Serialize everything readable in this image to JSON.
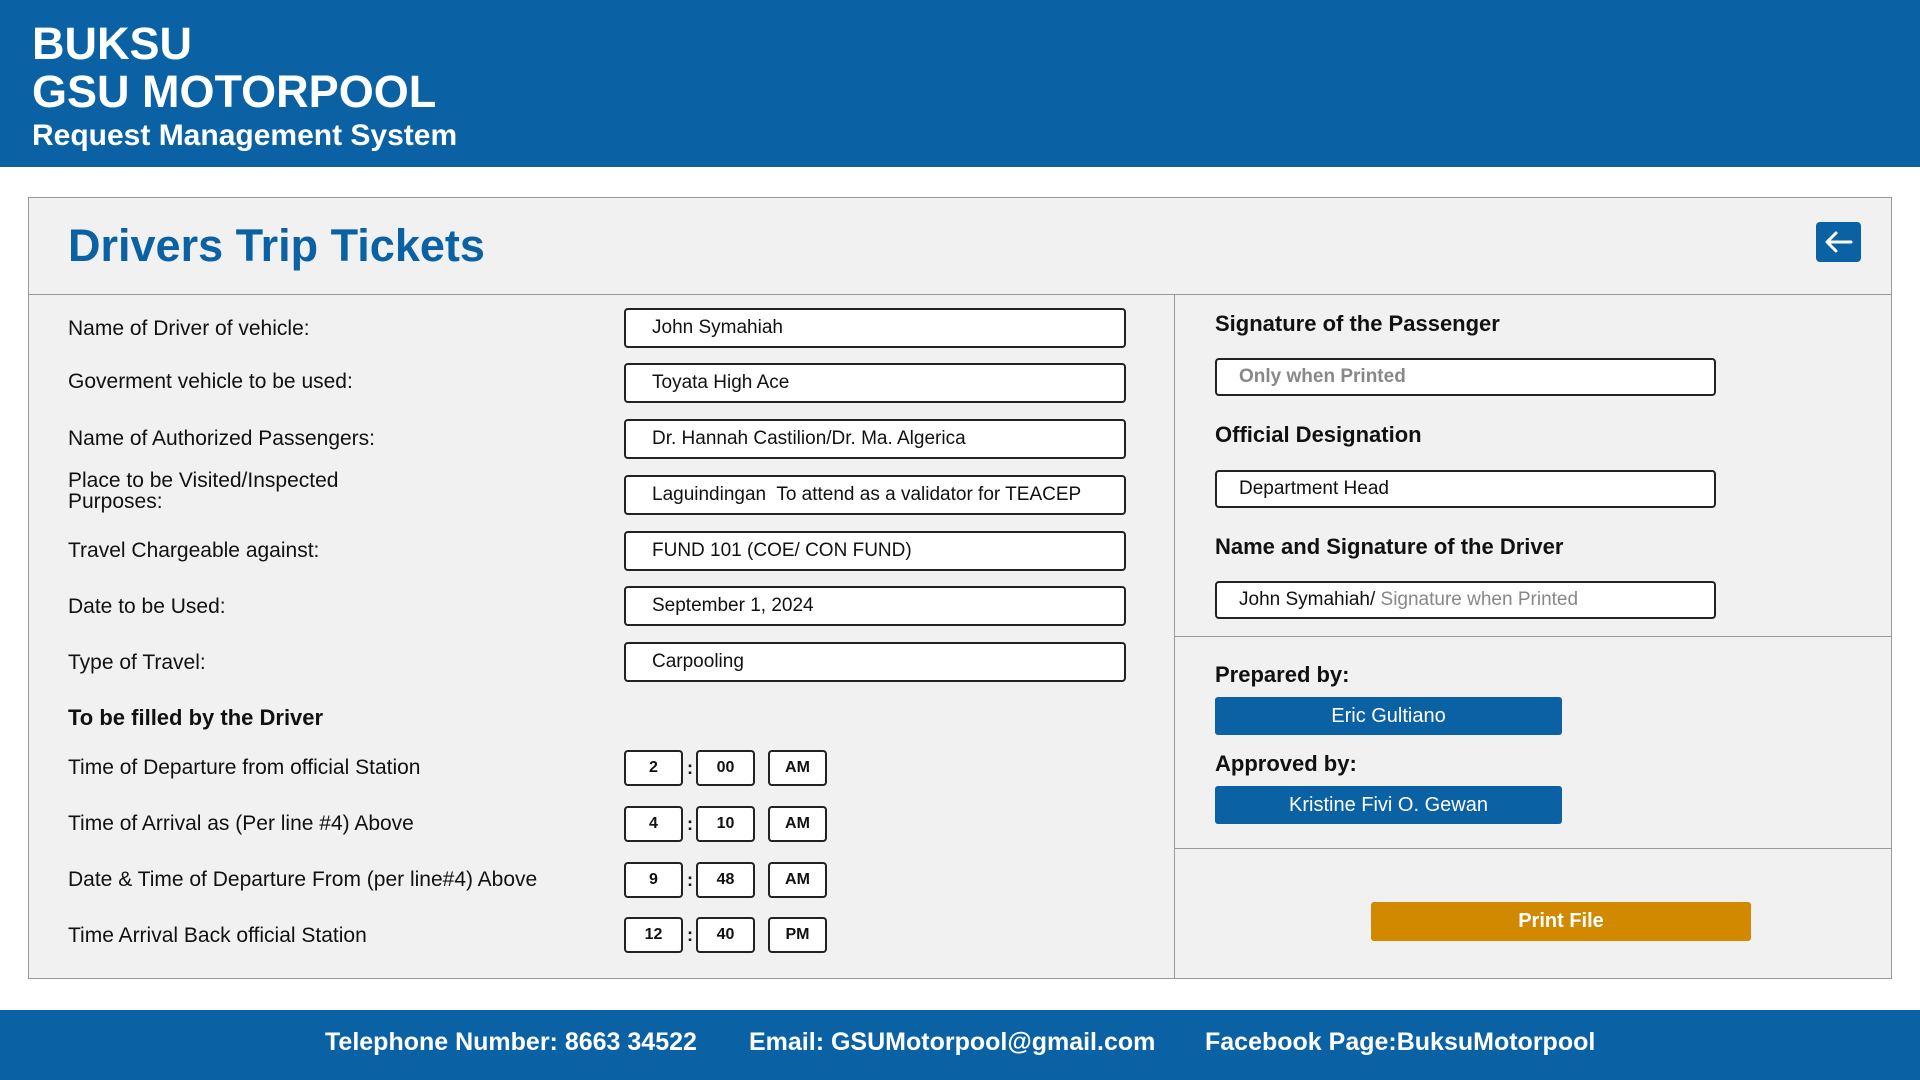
{
  "header": {
    "line1": "BUKSU",
    "line2": "GSU MOTORPOOL",
    "line3": "Request Management System"
  },
  "panel": {
    "title": "Drivers Trip Tickets",
    "back_icon": "arrow-left-icon"
  },
  "form": {
    "fields": [
      {
        "label": "Name of Driver of vehicle:",
        "value": "John Symahiah"
      },
      {
        "label": "Goverment vehicle to be used:",
        "value": "Toyata High Ace"
      },
      {
        "label": "Name of Authorized Passengers:",
        "value": "Dr. Hannah Castilion/Dr. Ma. Algerica"
      },
      {
        "label": "Place to be Visited/Inspected\nPurposes:",
        "value": "Laguindingan  To attend as a validator for TEACEP"
      },
      {
        "label": "Travel Chargeable against:",
        "value": "FUND 101 (COE/ CON FUND)"
      },
      {
        "label": "Date to be Used:",
        "value": "September 1, 2024"
      },
      {
        "label": "Type of Travel:",
        "value": "Carpooling"
      }
    ],
    "driver_section": "To be filled by the Driver",
    "times": [
      {
        "label": "Time of Departure from official Station",
        "hour": "2",
        "minute": "00",
        "ampm": "AM"
      },
      {
        "label": "Time of Arrival as (Per line #4) Above",
        "hour": "4",
        "minute": "10",
        "ampm": "AM"
      },
      {
        "label": "Date & Time of Departure  From (per line#4) Above",
        "hour": "9",
        "minute": "48",
        "ampm": "AM"
      },
      {
        "label": "Time Arrival Back official Station",
        "hour": "12",
        "minute": "40",
        "ampm": "PM"
      }
    ],
    "colon": ":"
  },
  "right": {
    "sig_passenger_label": "Signature of the Passenger",
    "sig_passenger_placeholder": "Only when Printed",
    "designation_label": "Official Designation",
    "designation_value": "Department Head",
    "driver_sig_label": "Name and Signature of the Driver",
    "driver_sig_value": "John Symahiah/ ",
    "driver_sig_placeholder": "Signature when Printed",
    "prepared_label": "Prepared by:",
    "prepared_name": "Eric Gultiano",
    "approved_label": "Approved by:",
    "approved_name": "Kristine Fivi O. Gewan",
    "print_label": "Print File"
  },
  "footer": {
    "telephone": "Telephone Number: 8663 34522",
    "email": "Email: GSUMotorpool@gmail.com",
    "facebook": "Facebook Page:BuksuMotorpool"
  },
  "colors": {
    "brand_blue": "#0a61a4",
    "print_orange": "#d18a00",
    "panel_bg": "#f1f1f1"
  }
}
